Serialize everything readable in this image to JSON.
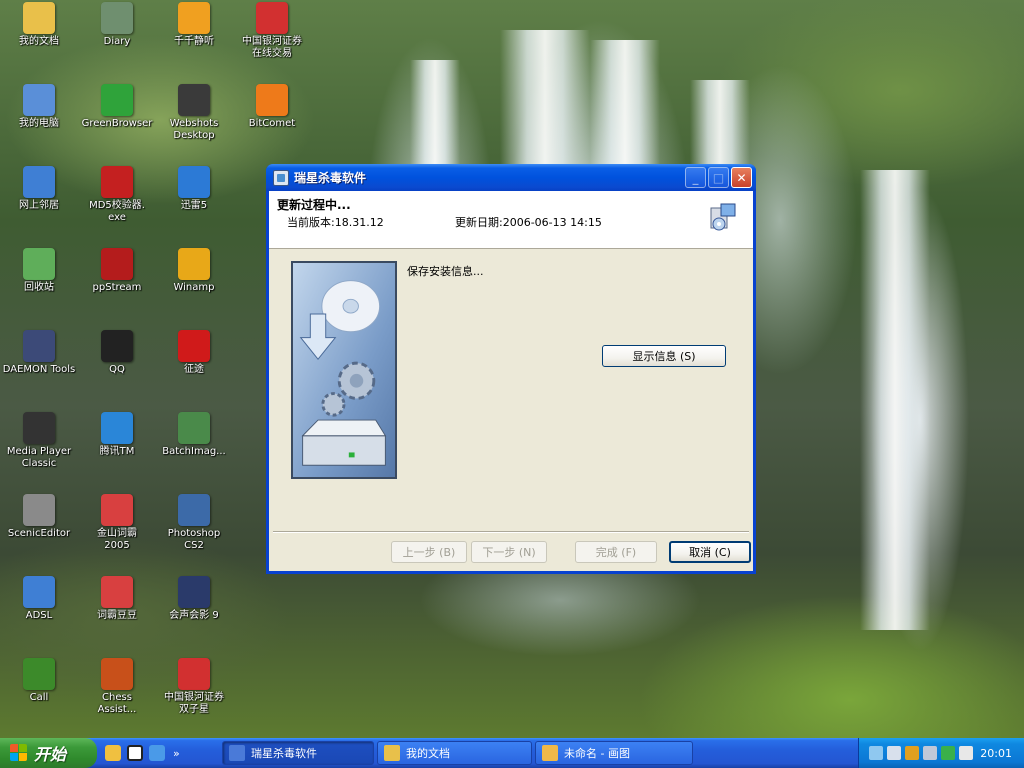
{
  "desktop": {
    "icons": [
      {
        "label": "我的文档",
        "icon": "my-documents-icon",
        "color": "#e9c04a"
      },
      {
        "label": "Diary",
        "icon": "diary-icon",
        "color": "#6f8f6f"
      },
      {
        "label": "千千静听",
        "icon": "ttplayer-icon",
        "color": "#f0a020"
      },
      {
        "label": "中国银河证券\n在线交易",
        "icon": "galaxy-securities-icon",
        "color": "#d23030"
      },
      {
        "label": "我的电脑",
        "icon": "my-computer-icon",
        "color": "#5a8fd8"
      },
      {
        "label": "GreenBrowser",
        "icon": "greenbrowser-icon",
        "color": "#2fa33a"
      },
      {
        "label": "Webshots\nDesktop",
        "icon": "webshots-icon",
        "color": "#3a3a3a"
      },
      {
        "label": "BitComet",
        "icon": "bitcomet-icon",
        "color": "#ee7a1a"
      },
      {
        "label": "网上邻居",
        "icon": "network-places-icon",
        "color": "#3f7fd4"
      },
      {
        "label": "MD5校验器.\nexe",
        "icon": "md5-checker-icon",
        "color": "#c42020"
      },
      {
        "label": "迅雷5",
        "icon": "thunder-icon",
        "color": "#2c7ad6"
      },
      {
        "label": "回收站",
        "icon": "recycle-bin-icon",
        "color": "#5fae5a"
      },
      {
        "label": "ppStream",
        "icon": "ppstream-icon",
        "color": "#b41c1c"
      },
      {
        "label": "Winamp",
        "icon": "winamp-icon",
        "color": "#e8a818"
      },
      {
        "label": "DAEMON Tools",
        "icon": "daemon-tools-icon",
        "color": "#3c4a78"
      },
      {
        "label": "QQ",
        "icon": "qq-icon",
        "color": "#222222"
      },
      {
        "label": "征途",
        "icon": "zhengtu-icon",
        "color": "#d01a1a"
      },
      {
        "label": "Media Player\nClassic",
        "icon": "media-player-classic-icon",
        "color": "#333333"
      },
      {
        "label": "腾讯TM",
        "icon": "tencent-tm-icon",
        "color": "#2a86d8"
      },
      {
        "label": "BatchImag...",
        "icon": "batch-image-icon",
        "color": "#4a8a4a"
      },
      {
        "label": "ScenicEditor",
        "icon": "scenic-editor-icon",
        "color": "#8a8a8a"
      },
      {
        "label": "金山词霸\n2005",
        "icon": "kingsoft-ciba-icon",
        "color": "#d84040"
      },
      {
        "label": "Photoshop\nCS2",
        "icon": "photoshop-icon",
        "color": "#3c6aa8"
      },
      {
        "label": "ADSL",
        "icon": "adsl-icon",
        "color": "#3f7fd4"
      },
      {
        "label": "词霸豆豆",
        "icon": "ciba-doudou-icon",
        "color": "#d84040"
      },
      {
        "label": "会声会影 9",
        "icon": "ulead-video-icon",
        "color": "#2a3a6a"
      },
      {
        "label": "Call",
        "icon": "call-tree-icon",
        "color": "#3c8a2a"
      },
      {
        "label": "Chess\nAssist...",
        "icon": "chess-assist-icon",
        "color": "#c8501a"
      },
      {
        "label": "中国银河证券\n双子星",
        "icon": "galaxy-gemini-icon",
        "color": "#d23030"
      }
    ]
  },
  "dialog": {
    "title": "瑞星杀毒软件",
    "header_title": "更新过程中...",
    "version_label": "当前版本:18.31.12",
    "date_label": "更新日期:2006-06-13 14:15",
    "status_text": "保存安装信息...",
    "show_info_label": "显示信息 (S)",
    "back_label": "上一步 (B)",
    "next_label": "下一步 (N)",
    "finish_label": "完成 (F)",
    "cancel_label": "取消 (C)",
    "minimize_glyph": "_",
    "maximize_glyph": "□",
    "close_glyph": "✕"
  },
  "taskbar": {
    "start_label": "开始",
    "more_glyph": "»",
    "tasks": [
      {
        "label": "瑞星杀毒软件",
        "icon": "rising-icon",
        "active": true
      },
      {
        "label": "我的文档",
        "icon": "folder-icon",
        "active": false
      },
      {
        "label": "未命名 - 画图",
        "icon": "paint-icon",
        "active": false
      }
    ],
    "clock": "20:01"
  },
  "colors": {
    "titlebar": "#0a5ee6",
    "taskbar": "#245edb",
    "start_button": "#3c9a3a",
    "dialog_face": "#ece9d8"
  }
}
